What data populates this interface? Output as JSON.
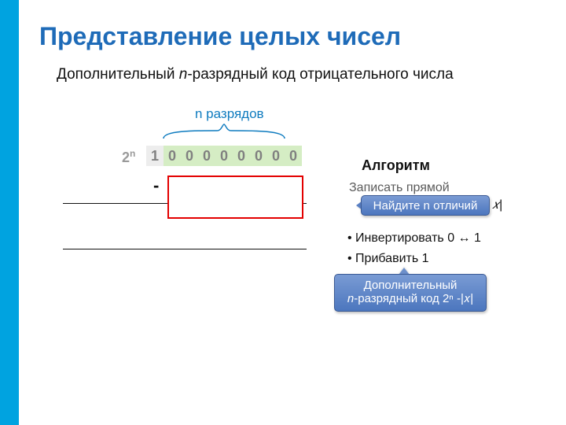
{
  "title": "Представление целых чисел",
  "subtitle_pre": "Дополнительный ",
  "subtitle_n": "n",
  "subtitle_post": "-разрядный код отрицательного числа",
  "two_n_html": "2",
  "two_n_sup": "n",
  "brace_label": "n разрядов",
  "bits": [
    "1",
    "0",
    "0",
    "0",
    "0",
    "0",
    "0",
    "0",
    "0"
  ],
  "minus": "-",
  "algorithm": {
    "title": "Алгоритм",
    "hidden_first": "Записать прямой",
    "hidden_absx": "𝑥|",
    "items": [
      "Инвертировать 0 ↔ 1",
      "Прибавить 1"
    ]
  },
  "callout1": "Найдите n отличий",
  "callout2_pre": "Дополнительный",
  "callout2_n": "n",
  "callout2_post": "-разрядный код 2ⁿ -|𝑥|"
}
